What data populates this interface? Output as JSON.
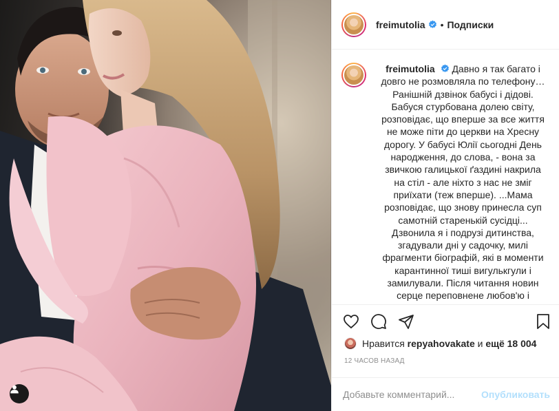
{
  "post": {
    "username": "freimutolia",
    "follow_label": "Подписки",
    "dot": "•",
    "caption_lines": [
      "Давно я так багато і",
      "довго не розмовляла по телефону…",
      "Ранішній дзвінок бабусі і дідові.",
      "Бабуся стурбована долею світу,",
      "розповідає, що вперше за все життя",
      "не може піти до церкви на Хресну",
      "дорогу. У бабусі Юлії сьогодні День",
      "народження, до слова, - вона за",
      "звичкою галицької ґаздині накрила",
      "на стіл - але ніхто з нас не зміг",
      "приїхати (теж вперше). ...Мама",
      "розповідає, що знову принесла суп",
      "самотній старенькій сусідці...",
      "Дзвонила я і подрузі дитинства,",
      "згадували дні у садочку, милі",
      "фрагменти біографій, які в моменти",
      "карантинної тиші вигулькгули і",
      "замилували. Після читання новин",
      "серце переповнене любов'ю і"
    ],
    "likes_prefix": "Нравится",
    "likes_user": "repyahovakate",
    "likes_mid": "и",
    "likes_count": "ещё 18 004",
    "timestamp": "12 часов назад",
    "comment_placeholder": "Добавьте комментарий...",
    "publish_label": "Опубликовать"
  },
  "icons": {
    "like": "heart-icon",
    "comment": "comment-icon",
    "share": "share-icon",
    "save": "bookmark-icon",
    "verified": "verified-badge-icon",
    "tagged_user": "user-tag-icon"
  },
  "colors": {
    "accent_verified": "#3897f0",
    "publish_disabled": "#b2dffc",
    "muted": "#8e8e8e",
    "border": "#efefef"
  }
}
